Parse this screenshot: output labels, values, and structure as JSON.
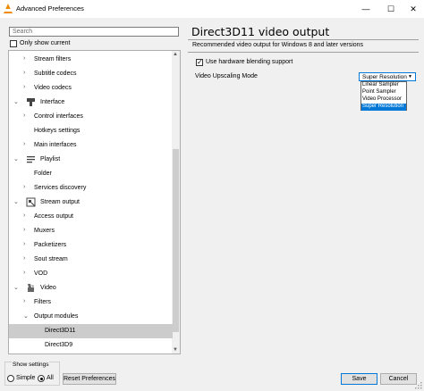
{
  "window": {
    "title": "Advanced Preferences",
    "controls": {
      "minimize": "—",
      "maximize": "☐",
      "close": "✕"
    }
  },
  "search": {
    "placeholder": "Search"
  },
  "filter": {
    "only_show_current": "Only show current",
    "checked": false
  },
  "tree": {
    "items": [
      {
        "label": "Stream filters",
        "level": 1,
        "arrow": "›",
        "icon": null,
        "selected": false
      },
      {
        "label": "Subtitle codecs",
        "level": 1,
        "arrow": "›",
        "icon": null,
        "selected": false
      },
      {
        "label": "Video codecs",
        "level": 1,
        "arrow": "›",
        "icon": null,
        "selected": false
      },
      {
        "label": "Interface",
        "level": 0,
        "arrow": "⌄",
        "icon": "interface-icon",
        "selected": false
      },
      {
        "label": "Control interfaces",
        "level": 1,
        "arrow": "›",
        "icon": null,
        "selected": false
      },
      {
        "label": "Hotkeys settings",
        "level": 1,
        "arrow": "",
        "icon": null,
        "selected": false
      },
      {
        "label": "Main interfaces",
        "level": 1,
        "arrow": "›",
        "icon": null,
        "selected": false
      },
      {
        "label": "Playlist",
        "level": 0,
        "arrow": "⌄",
        "icon": "playlist-icon",
        "selected": false
      },
      {
        "label": "Folder",
        "level": 1,
        "arrow": "",
        "icon": null,
        "selected": false
      },
      {
        "label": "Services discovery",
        "level": 1,
        "arrow": "›",
        "icon": null,
        "selected": false
      },
      {
        "label": "Stream output",
        "level": 0,
        "arrow": "⌄",
        "icon": "stream-output-icon",
        "selected": false
      },
      {
        "label": "Access output",
        "level": 1,
        "arrow": "›",
        "icon": null,
        "selected": false
      },
      {
        "label": "Muxers",
        "level": 1,
        "arrow": "›",
        "icon": null,
        "selected": false
      },
      {
        "label": "Packetizers",
        "level": 1,
        "arrow": "›",
        "icon": null,
        "selected": false
      },
      {
        "label": "Sout stream",
        "level": 1,
        "arrow": "›",
        "icon": null,
        "selected": false
      },
      {
        "label": "VOD",
        "level": 1,
        "arrow": "›",
        "icon": null,
        "selected": false
      },
      {
        "label": "Video",
        "level": 0,
        "arrow": "⌄",
        "icon": "video-icon",
        "selected": false
      },
      {
        "label": "Filters",
        "level": 1,
        "arrow": "›",
        "icon": null,
        "selected": false
      },
      {
        "label": "Output modules",
        "level": 1,
        "arrow": "⌄",
        "icon": null,
        "selected": false
      },
      {
        "label": "Direct3D11",
        "level": 2,
        "arrow": "",
        "icon": null,
        "selected": true
      },
      {
        "label": "Direct3D9",
        "level": 2,
        "arrow": "",
        "icon": null,
        "selected": false
      }
    ]
  },
  "show_settings": {
    "legend": "Show settings",
    "simple": "Simple",
    "all": "All",
    "selected": "all"
  },
  "buttons": {
    "reset": "Reset Preferences",
    "save": "Save",
    "cancel": "Cancel"
  },
  "panel": {
    "title": "Direct3D11 video output",
    "description": "Recommended video output for Windows 8 and later versions",
    "hw_blending": {
      "label": "Use hardware blending support",
      "checked": true
    },
    "upscaling": {
      "label": "Video Upscaling Mode",
      "selected": "Super Resolution",
      "options": [
        "Linear Sampler",
        "Point Sampler",
        "Video Processor",
        "Super Resolution"
      ],
      "highlighted": "Super Resolution",
      "open": true
    }
  },
  "colors": {
    "accent": "#0078d7",
    "selected_row": "#cccccc",
    "icon_orange": "#f08a00"
  }
}
